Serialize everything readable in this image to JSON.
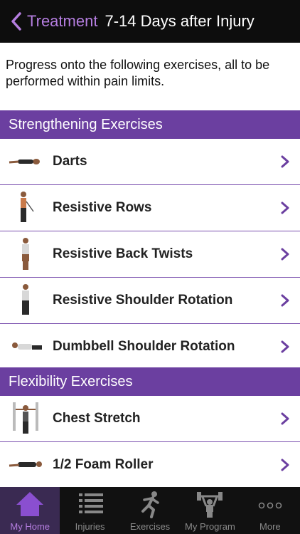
{
  "navbar": {
    "back_label": "Treatment",
    "title": "7-14 Days after Injury"
  },
  "intro": {
    "text": "Progress onto the following exercises, all to be performed within pain limits."
  },
  "sections": [
    {
      "header": "Strengthening Exercises",
      "items": [
        {
          "label": "Darts"
        },
        {
          "label": "Resistive Rows"
        },
        {
          "label": "Resistive Back Twists"
        },
        {
          "label": "Resistive Shoulder Rotation"
        },
        {
          "label": "Dumbbell Shoulder Rotation"
        }
      ]
    },
    {
      "header": "Flexibility Exercises",
      "items": [
        {
          "label": "Chest Stretch"
        },
        {
          "label": "1/2 Foam Roller"
        }
      ]
    }
  ],
  "tabbar": {
    "tabs": [
      {
        "label": "My Home",
        "icon": "house-icon",
        "active": true
      },
      {
        "label": "Injuries",
        "icon": "list-icon",
        "active": false
      },
      {
        "label": "Exercises",
        "icon": "runner-icon",
        "active": false
      },
      {
        "label": "My Program",
        "icon": "weightlifter-icon",
        "active": false
      },
      {
        "label": "More",
        "icon": "more-dots-icon",
        "active": false
      }
    ]
  },
  "colors": {
    "accent": "#6b3fa0",
    "accent_light": "#b57ee0",
    "navbar_bg": "#0d0d0d",
    "tabbar_bg": "#111111"
  }
}
